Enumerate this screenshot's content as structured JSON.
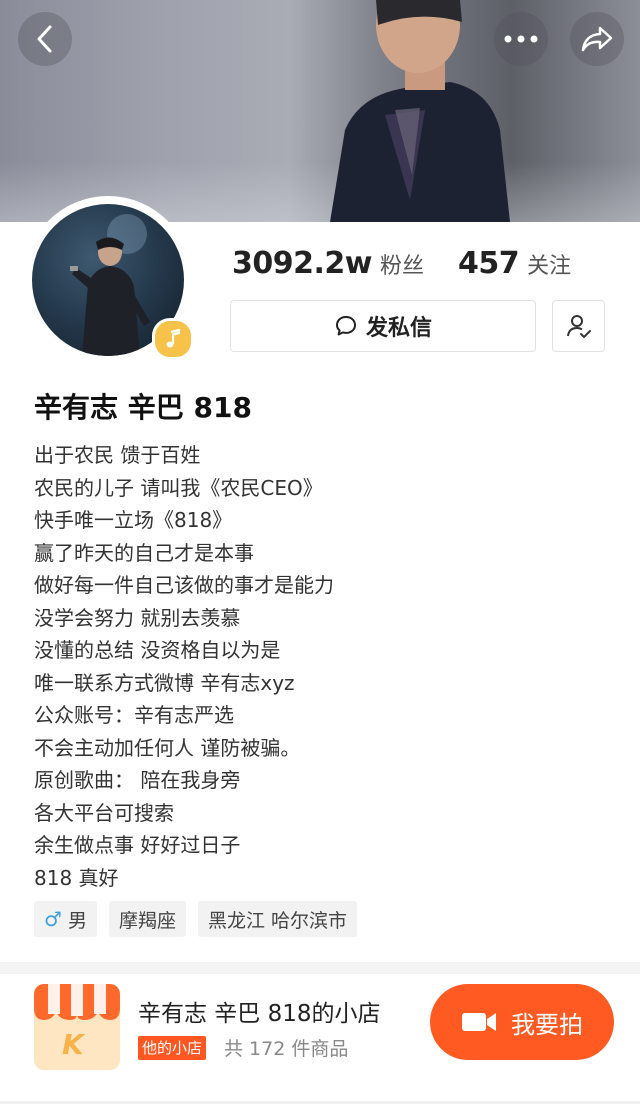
{
  "header": {
    "back_icon": "chevron-left-icon",
    "more_icon": "more-dots-icon",
    "share_icon": "share-arrow-icon"
  },
  "profile": {
    "fans_count": "3092.2w",
    "fans_label": "粉丝",
    "following_count": "457",
    "following_label": "关注",
    "message_button": "发私信",
    "badge_icon": "music-note-icon",
    "name": "辛有志 辛巴 818"
  },
  "bio": [
    "出于农民 馈于百姓",
    "农民的儿子  请叫我《农民CEO》",
    "快手唯一立场《818》",
    "赢了昨天的自己才是本事",
    "做好每一件自己该做的事才是能力",
    "没学会努力  就别去羡慕",
    "没懂的总结 没资格自以为是",
    "唯一联系方式微博  辛有志xyz",
    "公众账号：辛有志严选",
    "不会主动加任何人 谨防被骗。",
    "原创歌曲： 陪在我身旁",
    "各大平台可搜索",
    "余生做点事 好好过日子",
    "818 真好"
  ],
  "tags": {
    "gender_symbol": "♂",
    "gender": "男",
    "zodiac": "摩羯座",
    "location": "黑龙江 哈尔滨市"
  },
  "shop": {
    "title": "辛有志 辛巴 818的小店",
    "badge": "他的小店",
    "count": "共 172 件商品",
    "cta": "我要拍",
    "logo_letter": "K"
  },
  "colors": {
    "accent": "#ff5a22",
    "badge_yellow": "#f6c24a",
    "male_blue": "#3aa0e6"
  }
}
